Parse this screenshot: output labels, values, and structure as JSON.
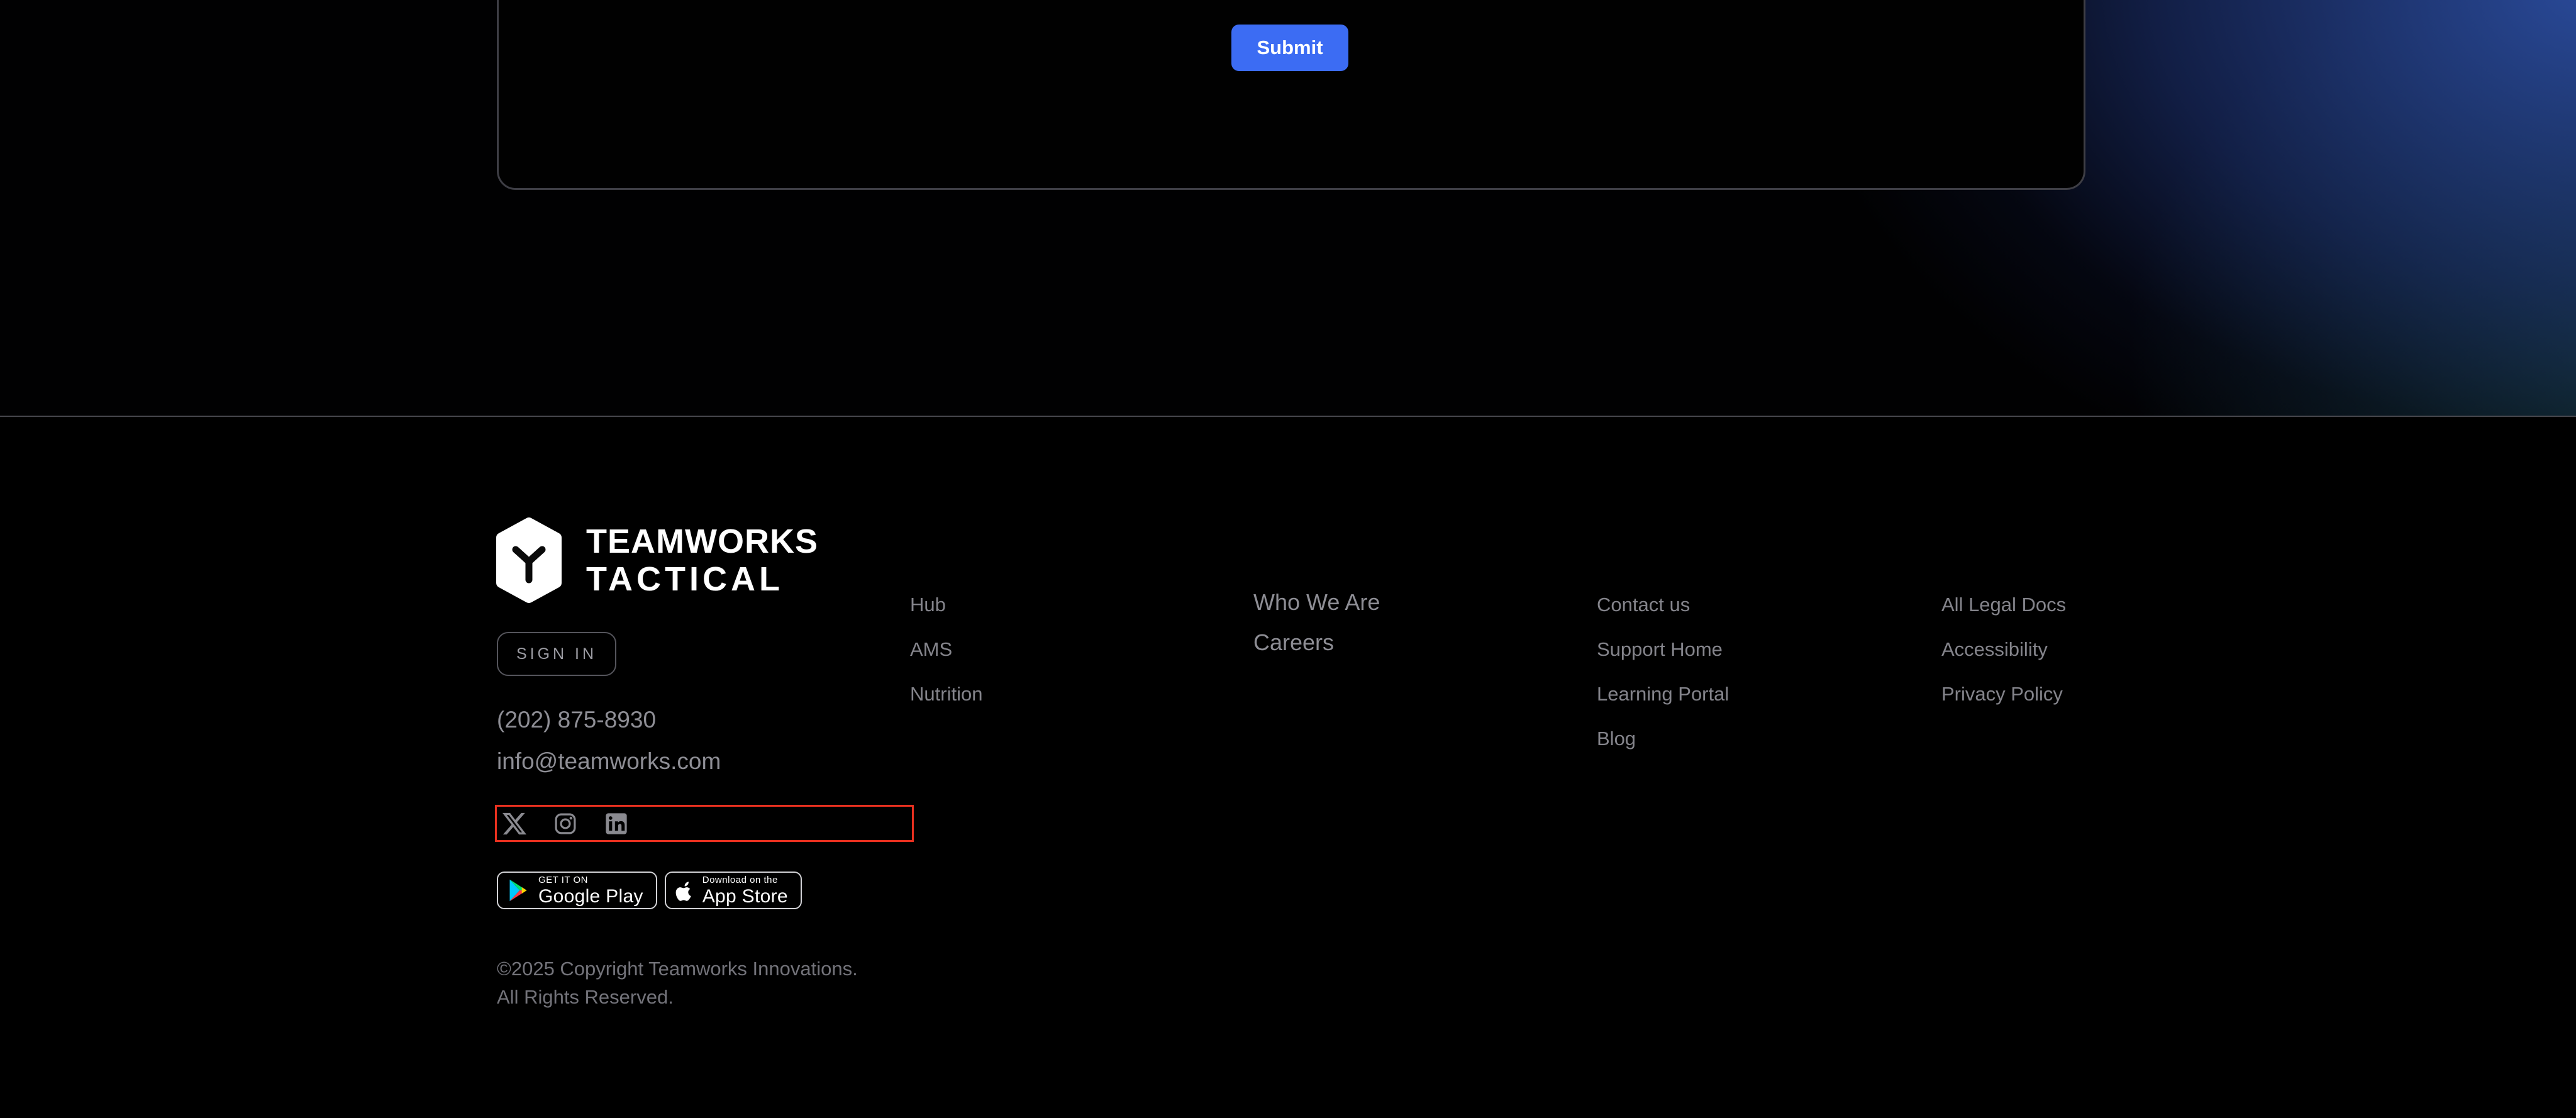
{
  "form_card": {
    "submit_label": "Submit"
  },
  "footer": {
    "brand": {
      "logo_line1": "TEAMWORKS",
      "logo_line2": "TACTICAL",
      "sign_in_label": "SIGN IN",
      "phone": "(202) 875-8930",
      "email": "info@teamworks.com"
    },
    "social_icons": [
      {
        "name": "x-icon"
      },
      {
        "name": "instagram-icon"
      },
      {
        "name": "linkedin-icon"
      }
    ],
    "badges": {
      "google_play": {
        "tagline": "GET IT ON",
        "store": "Google Play"
      },
      "app_store": {
        "tagline": "Download on the",
        "store": "App Store"
      }
    },
    "copyright": {
      "line1": "©2025 Copyright Teamworks Innovations.",
      "line2": "All Rights Reserved."
    },
    "nav_columns": [
      {
        "items": [
          {
            "label": "Hub"
          },
          {
            "label": "AMS"
          },
          {
            "label": "Nutrition"
          }
        ]
      },
      {
        "items": [
          {
            "label": "Who We Are"
          },
          {
            "label": "Careers"
          }
        ]
      },
      {
        "items": [
          {
            "label": "Contact us"
          },
          {
            "label": "Support Home"
          },
          {
            "label": "Learning Portal"
          },
          {
            "label": "Blog"
          }
        ]
      },
      {
        "items": [
          {
            "label": "All Legal Docs"
          },
          {
            "label": "Accessibility"
          },
          {
            "label": "Privacy Policy"
          }
        ]
      }
    ]
  },
  "colors": {
    "accent_blue": "#3C6CF3",
    "highlight_red": "#E8301F",
    "link_gray": "#85858C",
    "card_border": "#3E3E45",
    "background": "#000000"
  }
}
